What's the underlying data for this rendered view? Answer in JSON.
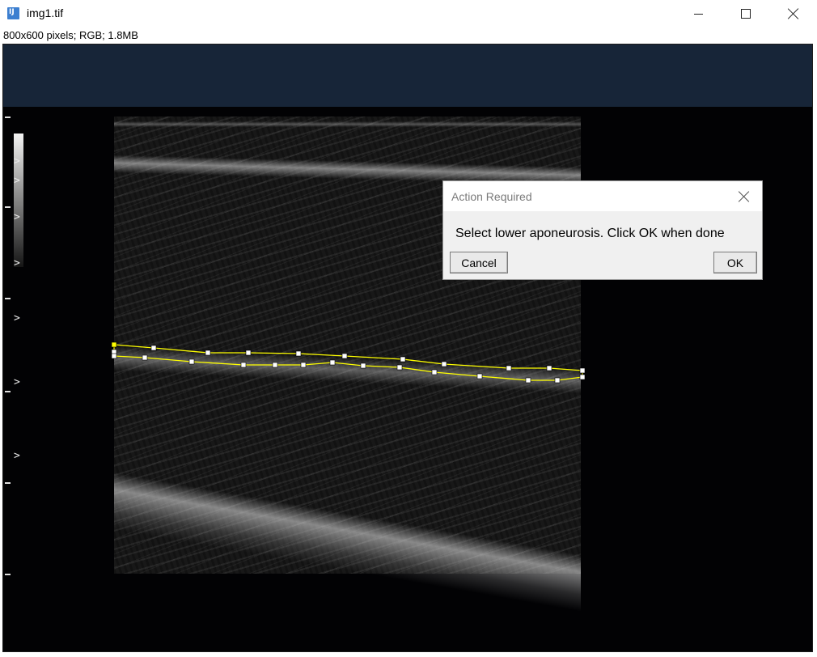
{
  "window": {
    "title": "img1.tif",
    "icon": "imagej-icon",
    "controls": [
      "minimize",
      "maximize",
      "close"
    ]
  },
  "image_info": "800x600 pixels; RGB; 1.8MB",
  "canvas": {
    "depth_markers": [
      ">",
      ">",
      ">",
      ">",
      ">",
      ">",
      ">"
    ],
    "roi_color": "#ffff00",
    "handle_color": "#ffffff"
  },
  "dialog": {
    "title": "Action Required",
    "message": "Select lower aponeurosis. Click OK when done",
    "cancel_label": "Cancel",
    "ok_label": "OK"
  }
}
